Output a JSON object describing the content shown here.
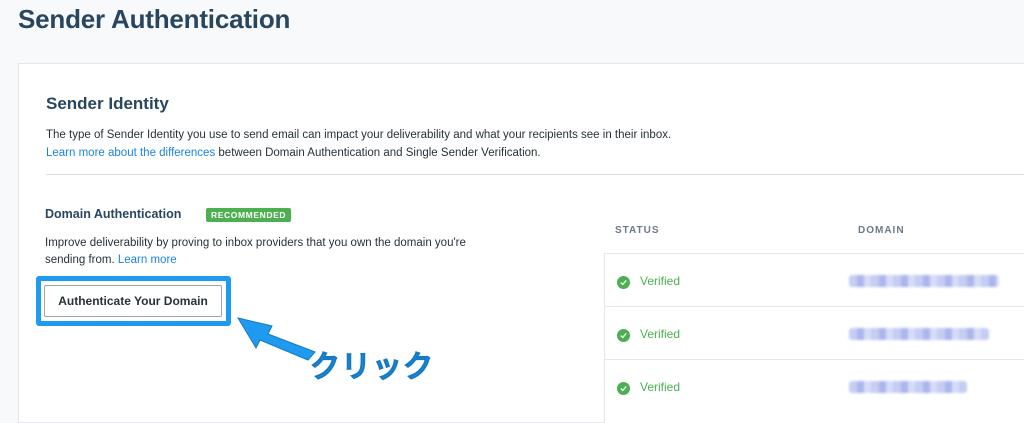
{
  "page": {
    "title": "Sender Authentication"
  },
  "sender_identity": {
    "title": "Sender Identity",
    "description": "The type of Sender Identity you use to send email can impact your deliverability and what your recipients see in their inbox.",
    "learn_link": "Learn more about the differences",
    "learn_suffix": " between Domain Authentication and Single Sender Verification."
  },
  "domain_auth": {
    "title": "Domain Authentication",
    "badge": "RECOMMENDED",
    "description_line1": "Improve deliverability by proving to inbox providers that you own the domain you're",
    "description_line2": "sending from. ",
    "learn_more": "Learn more",
    "button_label": "Authenticate Your Domain"
  },
  "annotation": {
    "label": "クリック",
    "color": "#1e9bf0"
  },
  "table": {
    "columns": [
      "STATUS",
      "DOMAIN"
    ],
    "rows": [
      {
        "status": "Verified"
      },
      {
        "status": "Verified"
      },
      {
        "status": "Verified"
      }
    ]
  },
  "colors": {
    "heading": "#294661",
    "link": "#1a82e2",
    "success": "#4caf50",
    "highlight": "#1e9bf0"
  }
}
